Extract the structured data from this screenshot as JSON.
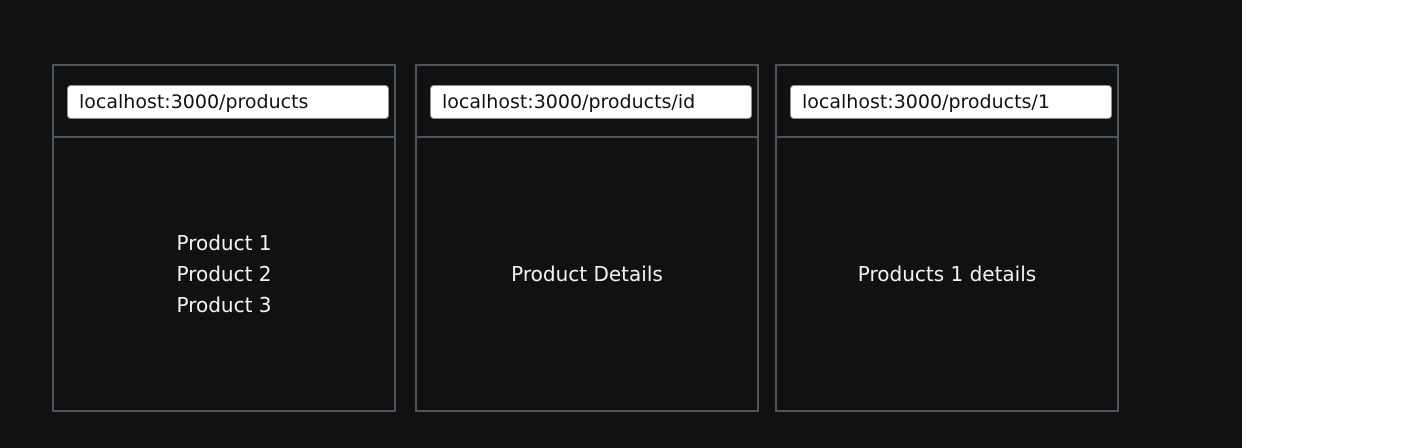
{
  "browsers": [
    {
      "url": "localhost:3000/products",
      "lines": [
        "Product 1",
        "Product 2",
        "Product 3"
      ]
    },
    {
      "url": "localhost:3000/products/id",
      "text": "Product Details"
    },
    {
      "url": "localhost:3000/products/1",
      "text": "Products 1 details"
    }
  ]
}
